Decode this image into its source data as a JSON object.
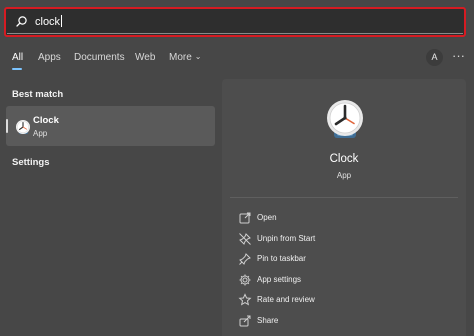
{
  "search": {
    "query": "clock"
  },
  "tabs": [
    {
      "label": "All",
      "active": true
    },
    {
      "label": "Apps"
    },
    {
      "label": "Documents"
    },
    {
      "label": "Web"
    },
    {
      "label": "More"
    }
  ],
  "account": {
    "initial": "A",
    "more_glyph": "···"
  },
  "best_match": {
    "heading": "Best match",
    "title": "Clock",
    "subtitle": "App",
    "icon": "clock-icon"
  },
  "settings": {
    "heading": "Settings"
  },
  "detail": {
    "title": "Clock",
    "subtitle": "App",
    "actions": [
      {
        "label": "Open",
        "icon": "open-icon"
      },
      {
        "label": "Unpin from Start",
        "icon": "unpin-icon"
      },
      {
        "label": "Pin to taskbar",
        "icon": "pin-icon"
      },
      {
        "label": "App settings",
        "icon": "gear-icon"
      },
      {
        "label": "Rate and review",
        "icon": "star-icon"
      },
      {
        "label": "Share",
        "icon": "share-icon"
      }
    ]
  },
  "colors": {
    "background": "#474747",
    "search_border": "#d61b22",
    "accent": "#7cc4ff",
    "card": "#5a5a5a",
    "panel": "#4d4d4d"
  }
}
